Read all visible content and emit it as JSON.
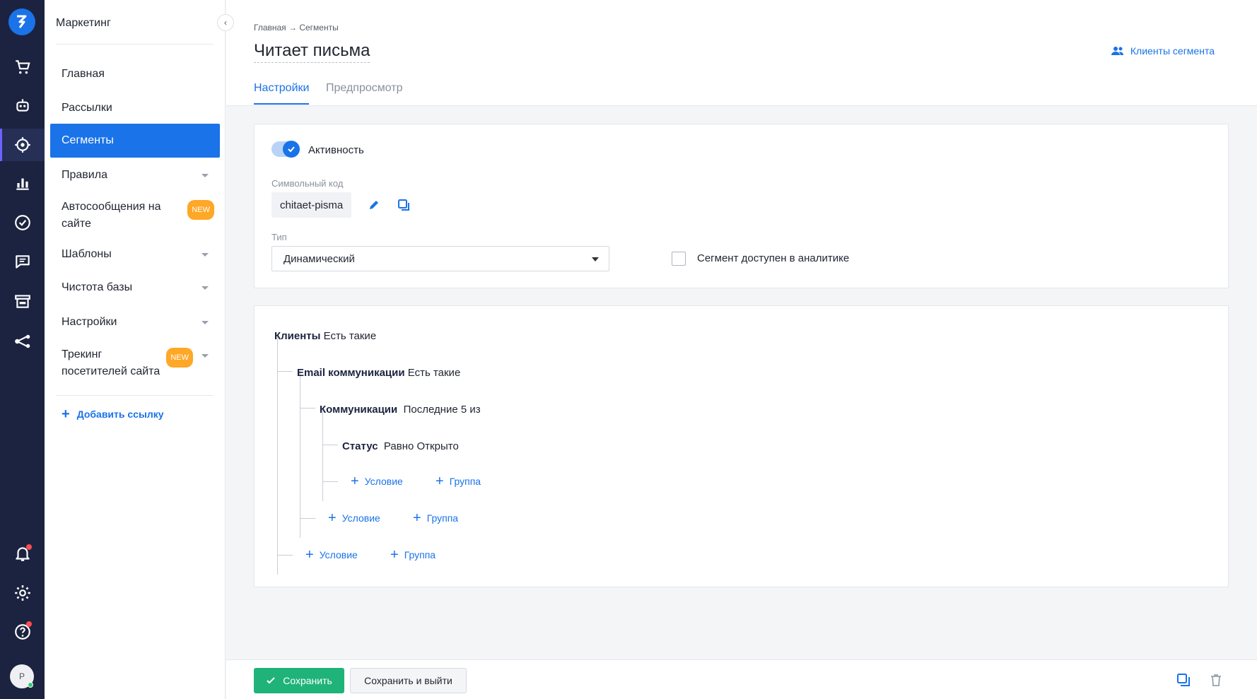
{
  "rail": {
    "items": [
      "logo-icon",
      "cart-icon",
      "bot-icon",
      "target-icon",
      "chart-icon",
      "check-icon",
      "chat-icon",
      "store-icon",
      "share-icon",
      "bell-icon",
      "gear-icon",
      "help-icon"
    ],
    "avatar_letter": "Р",
    "accent": "#6c63ff"
  },
  "nav": {
    "title": "Маркетинг",
    "items": [
      {
        "label": "Главная"
      },
      {
        "label": "Рассылки"
      },
      {
        "label": "Сегменты"
      },
      {
        "label": "Правила"
      },
      {
        "label": "Автосообщения на сайте",
        "badge": "NEW"
      },
      {
        "label": "Шаблоны"
      },
      {
        "label": "Чистота базы"
      },
      {
        "label": "Настройки"
      },
      {
        "label": "Трекинг посетителей сайта",
        "badge": "NEW"
      }
    ],
    "add_link": "Добавить ссылку"
  },
  "header": {
    "breadcrumb": "Главная → Сегменты",
    "title": "Читает письма",
    "clients_link": "Клиенты сегмента",
    "tabs": [
      "Настройки",
      "Предпросмотр"
    ]
  },
  "settings": {
    "activity_label": "Активность",
    "code_label": "Символьный код",
    "code_value": "chitaet-pisma",
    "type_label": "Тип",
    "type_value": "Динамический",
    "analytics_label": "Сегмент доступен в аналитике"
  },
  "tree": {
    "n1_bold": "Клиенты",
    "n1_text": "Есть такие",
    "n2_bold": "Email коммуникации",
    "n2_text": "Есть такие",
    "n3_bold": "Коммуникации",
    "n3_text": "Последние 5 из",
    "n4_bold": "Статус",
    "n4_text": "Равно Открыто",
    "add_condition": "Условие",
    "add_group": "Группа"
  },
  "footer": {
    "save": "Сохранить",
    "save_exit": "Сохранить и выйти"
  },
  "colors": {
    "primary": "#1a73e8",
    "success": "#1fb37a",
    "rail_bg": "#1c2340",
    "badge": "#ffa726"
  }
}
